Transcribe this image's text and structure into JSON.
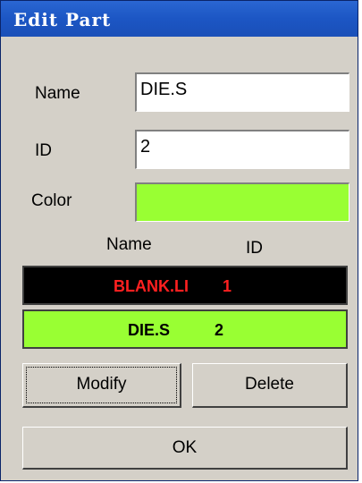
{
  "window": {
    "title": "Edit Part"
  },
  "form": {
    "name_label": "Name",
    "name_value": "DIE.S",
    "id_label": "ID",
    "id_value": "2",
    "color_label": "Color",
    "color_value": "#99ff33"
  },
  "list": {
    "headers": {
      "name": "Name",
      "id": "ID"
    },
    "rows": [
      {
        "name": "BLANK.LI",
        "id": "1",
        "bg": "#000000",
        "fg": "#ff2020"
      },
      {
        "name": "DIE.S",
        "id": "2",
        "bg": "#99ff33",
        "fg": "#000000"
      }
    ]
  },
  "buttons": {
    "modify": "Modify",
    "delete": "Delete",
    "ok": "OK"
  }
}
